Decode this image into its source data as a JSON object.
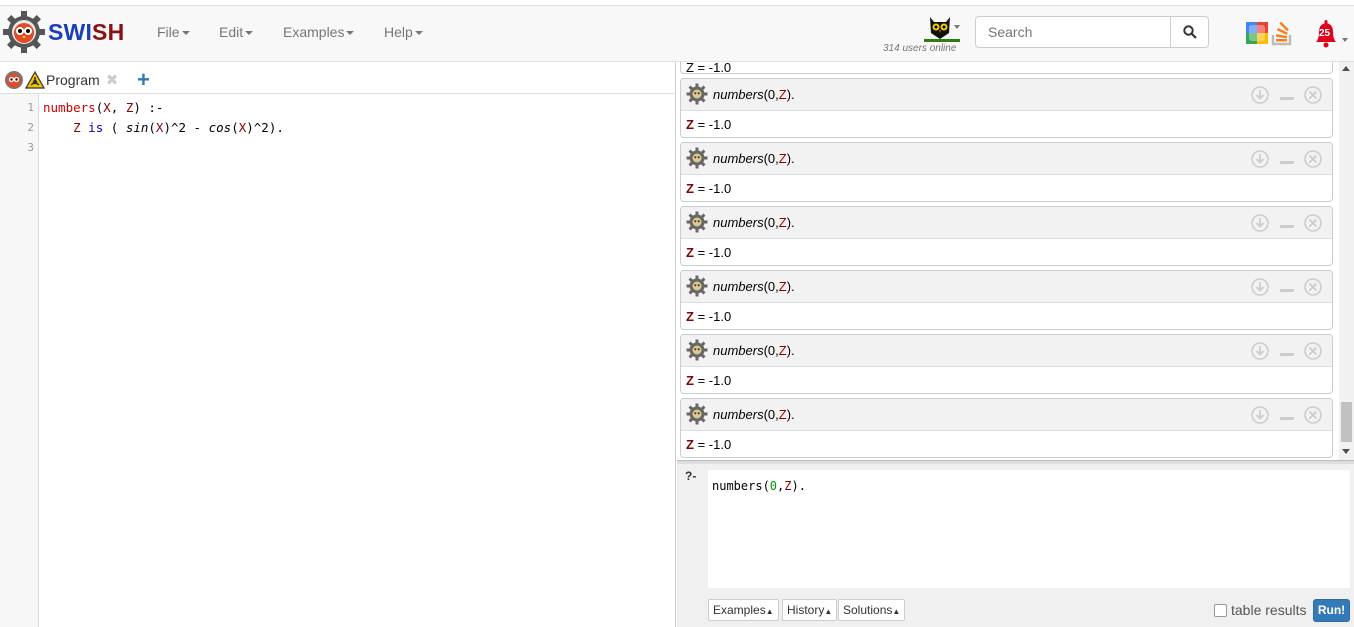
{
  "app": {
    "brand_part1": "SWI",
    "brand_part2": "SH"
  },
  "menu": [
    {
      "label": "File"
    },
    {
      "label": "Edit"
    },
    {
      "label": "Examples"
    },
    {
      "label": "Help"
    }
  ],
  "header": {
    "users_online": "314 users online",
    "search_placeholder": "Search",
    "notification_count": "25"
  },
  "editor": {
    "tab_label": "Program",
    "line_numbers": [
      "1",
      "2",
      "3"
    ]
  },
  "answers": {
    "partial_result": "Z = -1.0",
    "blocks": [
      {
        "query_fn": "numbers",
        "query_args_open": "(0,",
        "query_var": "Z",
        "query_close": ").",
        "result_var": "Z",
        "result_value": " = -1.0"
      },
      {
        "query_fn": "numbers",
        "query_args_open": "(0,",
        "query_var": "Z",
        "query_close": ").",
        "result_var": "Z",
        "result_value": " = -1.0"
      },
      {
        "query_fn": "numbers",
        "query_args_open": "(0,",
        "query_var": "Z",
        "query_close": ").",
        "result_var": "Z",
        "result_value": " = -1.0"
      },
      {
        "query_fn": "numbers",
        "query_args_open": "(0,",
        "query_var": "Z",
        "query_close": ").",
        "result_var": "Z",
        "result_value": " = -1.0"
      },
      {
        "query_fn": "numbers",
        "query_args_open": "(0,",
        "query_var": "Z",
        "query_close": ").",
        "result_var": "Z",
        "result_value": " = -1.0"
      },
      {
        "query_fn": "numbers",
        "query_args_open": "(0,",
        "query_var": "Z",
        "query_close": ").",
        "result_var": "Z",
        "result_value": " = -1.0"
      }
    ]
  },
  "query": {
    "prompt": "?-",
    "text_fn": "numbers(",
    "text_num": "0",
    "text_comma": ",",
    "text_var": "Z",
    "text_close": ").",
    "examples_label": "Examples",
    "history_label": "History",
    "solutions_label": "Solutions",
    "table_results_label": "table results",
    "run_label": "Run!"
  },
  "colors": {
    "brand_blue": "#1a3eb5",
    "brand_red": "#8b1010",
    "run_button": "#337ab7",
    "variable": "#8b0000"
  }
}
